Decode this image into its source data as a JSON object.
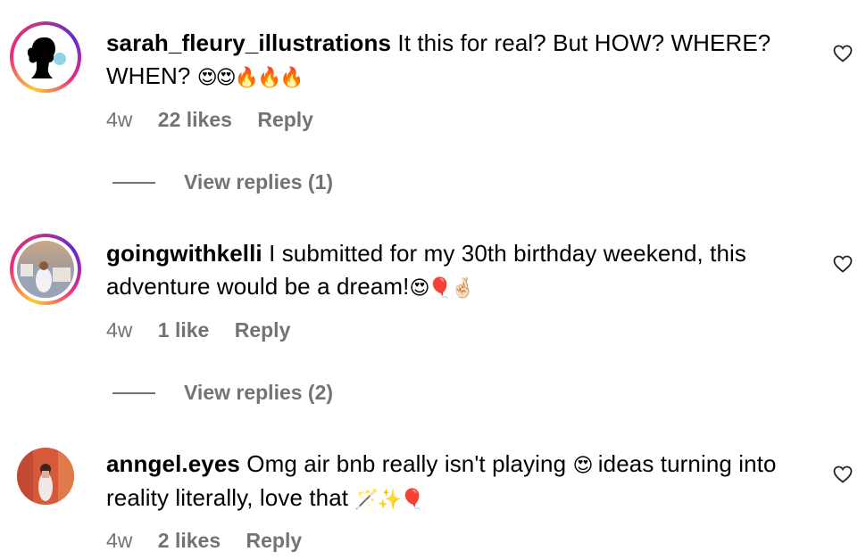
{
  "comments": [
    {
      "username": "sarah_fleury_illustrations",
      "text": "It this for real? But HOW? WHERE? WHEN?",
      "emojis": "😍😍🔥🔥🔥",
      "time": "4w",
      "likes": "22 likes",
      "reply": "Reply",
      "view_replies": "View replies (1)",
      "avatar_icon": "silhouette-bubblegum-icon"
    },
    {
      "username": "goingwithkelli",
      "text": "I submitted for my 30th birthday weekend, this adventure would be a dream!",
      "emojis": "😍🎈🤞🏻",
      "time": "4w",
      "likes": "1 like",
      "reply": "Reply",
      "view_replies": "View replies (2)",
      "avatar_icon": "photo-avatar"
    },
    {
      "username": "anngel.eyes",
      "text": "Omg air bnb really isn't playing",
      "emoji_mid": "😍",
      "text2": "ideas turning into reality literally, love that",
      "emojis": "🪄✨🎈",
      "time": "4w",
      "likes": "2 likes",
      "reply": "Reply",
      "avatar_icon": "photo-avatar"
    }
  ],
  "colors": {
    "secondary_text": "#737373",
    "primary_text": "#000000",
    "story_ring": [
      "#f9ce34",
      "#ee2a7b",
      "#6228d7"
    ]
  }
}
